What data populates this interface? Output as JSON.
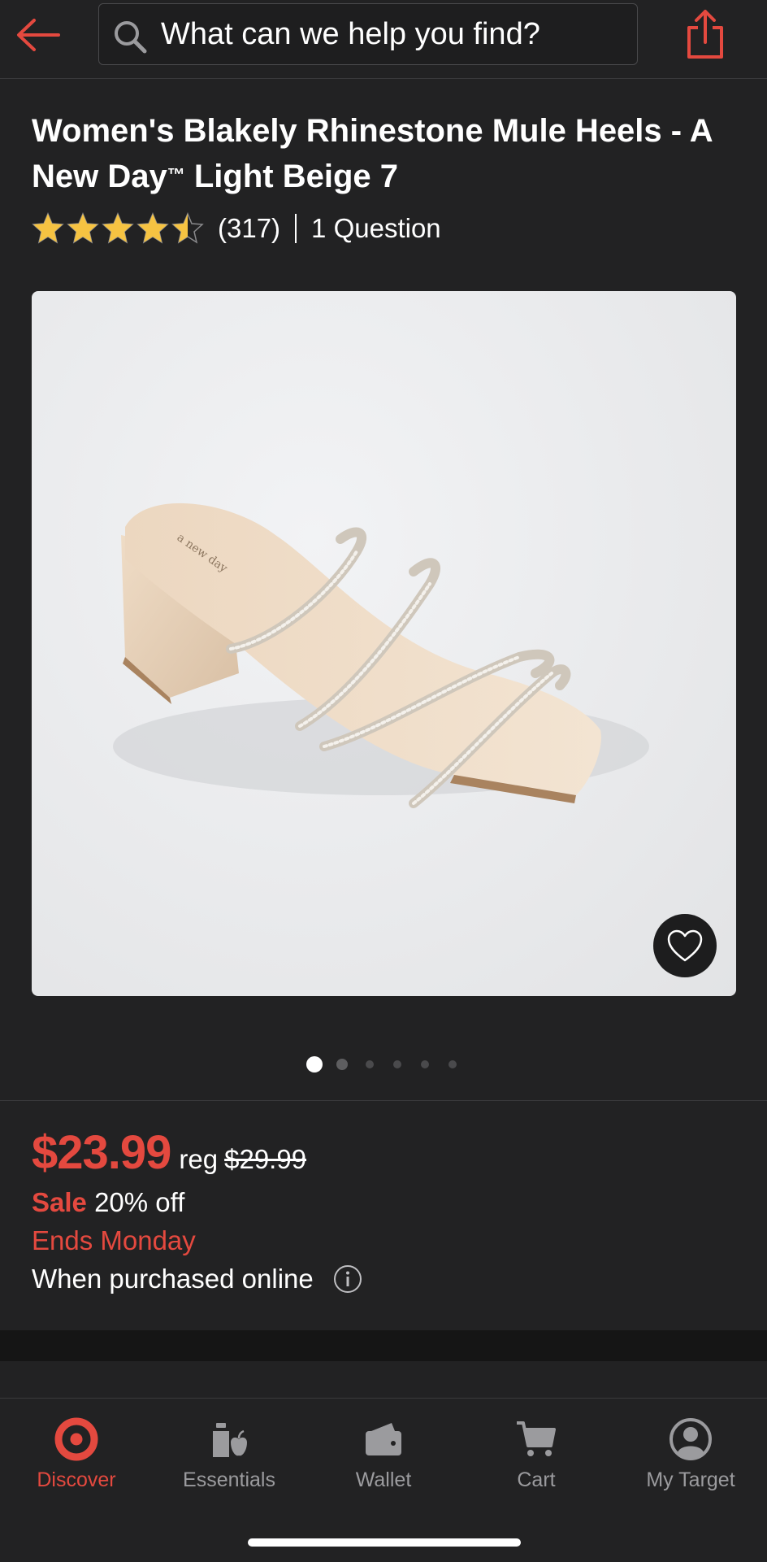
{
  "colors": {
    "accent": "#e4493f",
    "background": "#222223",
    "star": "#f6c342",
    "muted": "#9b9b9e"
  },
  "header": {
    "back_icon": "arrow-left-icon",
    "search_placeholder": "What can we help you find?",
    "share_icon": "share-icon"
  },
  "product": {
    "title_main": "Women's Blakely Rhinestone Mule Heels - A New Day",
    "title_tm": "™",
    "title_tail": " Light Beige 7",
    "rating": 4.5,
    "rating_max": 5,
    "review_count": "(317)",
    "questions": "1 Question",
    "image_count": 6,
    "active_image": 1
  },
  "pricing": {
    "price": "$23.99",
    "reg_label": "reg",
    "reg_price": "$29.99",
    "sale_label": "Sale",
    "discount": "20% off",
    "ends": "Ends Monday",
    "online_note": "When purchased online"
  },
  "nav": {
    "items": [
      {
        "label": "Discover",
        "icon": "target-icon",
        "active": true
      },
      {
        "label": "Essentials",
        "icon": "essentials-icon",
        "active": false
      },
      {
        "label": "Wallet",
        "icon": "wallet-icon",
        "active": false
      },
      {
        "label": "Cart",
        "icon": "cart-icon",
        "active": false
      },
      {
        "label": "My Target",
        "icon": "user-circle-icon",
        "active": false
      }
    ]
  }
}
